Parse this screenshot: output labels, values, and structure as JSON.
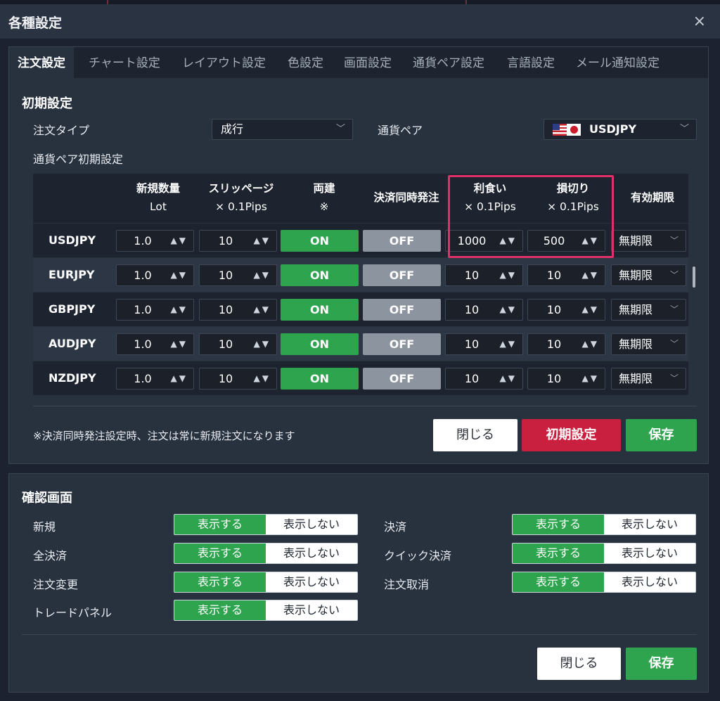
{
  "window": {
    "title": "各種設定",
    "close_icon": "×"
  },
  "tabs": [
    "注文設定",
    "チャート設定",
    "レイアウト設定",
    "色設定",
    "画面設定",
    "通貨ペア設定",
    "言語設定",
    "メール通知設定"
  ],
  "initial": {
    "section_title": "初期設定",
    "order_type_label": "注文タイプ",
    "order_type_value": "成行",
    "pair_label": "通貨ペア",
    "pair_value": "USDJPY",
    "pair_defaults_label": "通貨ペア初期設定"
  },
  "grid": {
    "headers": {
      "lot_1": "新規数量",
      "lot_2": "Lot",
      "slip_1": "スリッページ",
      "slip_2": "× 0.1Pips",
      "both_1": "両建",
      "both_2": "※",
      "simul": "決済同時発注",
      "tp_1": "利食い",
      "tp_2": "× 0.1Pips",
      "sl_1": "損切り",
      "sl_2": "× 0.1Pips",
      "expiry": "有効期限"
    },
    "rows": [
      {
        "pair": "USDJPY",
        "lot": "1.0",
        "slip": "10",
        "both": "ON",
        "simul": "OFF",
        "tp": "1000",
        "sl": "500",
        "expiry": "無期限"
      },
      {
        "pair": "EURJPY",
        "lot": "1.0",
        "slip": "10",
        "both": "ON",
        "simul": "OFF",
        "tp": "10",
        "sl": "10",
        "expiry": "無期限"
      },
      {
        "pair": "GBPJPY",
        "lot": "1.0",
        "slip": "10",
        "both": "ON",
        "simul": "OFF",
        "tp": "10",
        "sl": "10",
        "expiry": "無期限"
      },
      {
        "pair": "AUDJPY",
        "lot": "1.0",
        "slip": "10",
        "both": "ON",
        "simul": "OFF",
        "tp": "10",
        "sl": "10",
        "expiry": "無期限"
      },
      {
        "pair": "NZDJPY",
        "lot": "1.0",
        "slip": "10",
        "both": "ON",
        "simul": "OFF",
        "tp": "10",
        "sl": "10",
        "expiry": "無期限"
      }
    ],
    "arrows": "▲▼",
    "chevron": "﹀"
  },
  "note": "※決済同時発注設定時、注文は常に新規注文になります",
  "buttons": {
    "close": "閉じる",
    "reset": "初期設定",
    "save": "保存"
  },
  "confirm": {
    "section_title": "確認画面",
    "show": "表示する",
    "hide": "表示しない",
    "items": {
      "new": "新規",
      "settle": "決済",
      "all_settle": "全決済",
      "quick_settle": "クイック決済",
      "modify": "注文変更",
      "cancel": "注文取消",
      "trade_panel": "トレードパネル"
    }
  },
  "colors": {
    "accent_green": "#2ea44f",
    "accent_red": "#c8203e",
    "highlight": "#e0306a"
  }
}
